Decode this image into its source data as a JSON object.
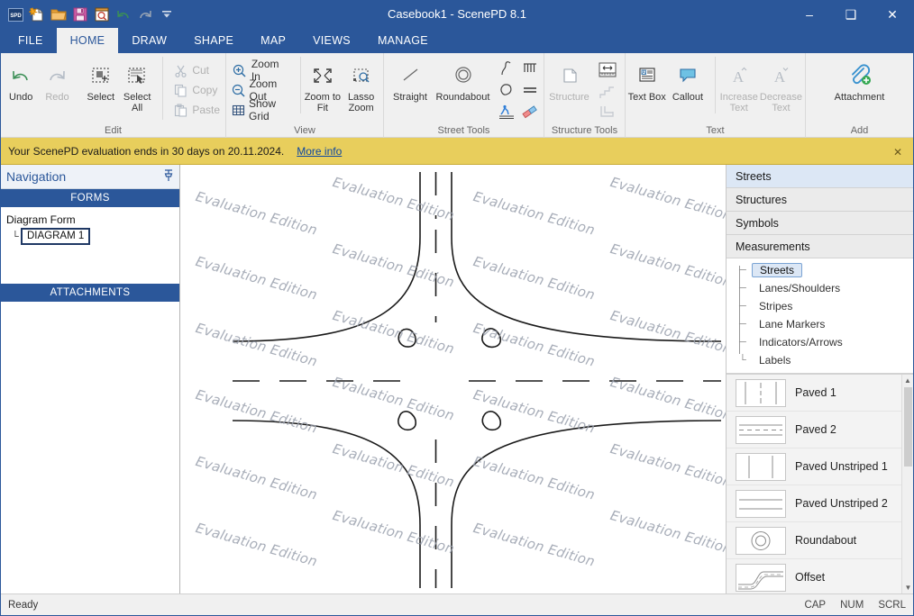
{
  "window": {
    "title": "Casebook1 - ScenePD 8.1",
    "minimize": "–",
    "maximize": "❑",
    "close": "✕"
  },
  "quick_access": [
    {
      "name": "app-logo-icon",
      "label": "SPD"
    },
    {
      "name": "new-casebook-icon",
      "label": "New"
    },
    {
      "name": "open-folder-icon",
      "label": "Open"
    },
    {
      "name": "save-icon",
      "label": "Save"
    },
    {
      "name": "print-preview-icon",
      "label": "Print Preview"
    },
    {
      "name": "undo-icon",
      "label": "Undo"
    },
    {
      "name": "redo-icon",
      "label": "Redo"
    },
    {
      "name": "customize-qat-icon",
      "label": "Customize Quick Access Toolbar"
    }
  ],
  "tabs": [
    {
      "label": "FILE",
      "active": false
    },
    {
      "label": "HOME",
      "active": true
    },
    {
      "label": "DRAW",
      "active": false
    },
    {
      "label": "SHAPE",
      "active": false
    },
    {
      "label": "MAP",
      "active": false
    },
    {
      "label": "VIEWS",
      "active": false
    },
    {
      "label": "MANAGE",
      "active": false
    }
  ],
  "ribbon": {
    "groups": [
      {
        "label": "Edit",
        "big": [
          {
            "label": "Undo",
            "icon": "undo-icon",
            "disabled": false
          },
          {
            "label": "Redo",
            "icon": "redo-icon",
            "disabled": true
          },
          {
            "label": "Select",
            "icon": "select-icon",
            "disabled": false
          },
          {
            "label": "Select All",
            "icon": "select-all-icon",
            "disabled": false
          }
        ],
        "small": [
          {
            "label": "Cut",
            "icon": "cut-icon",
            "disabled": true
          },
          {
            "label": "Copy",
            "icon": "copy-icon",
            "disabled": true
          },
          {
            "label": "Paste",
            "icon": "paste-icon",
            "disabled": true
          }
        ]
      },
      {
        "label": "View",
        "small": [
          {
            "label": "Zoom In",
            "icon": "zoom-in-icon",
            "disabled": false
          },
          {
            "label": "Zoom Out",
            "icon": "zoom-out-icon",
            "disabled": false
          },
          {
            "label": "Show Grid",
            "icon": "grid-icon",
            "disabled": false
          }
        ],
        "big": [
          {
            "label": "Zoom to Fit",
            "icon": "zoom-to-fit-icon",
            "disabled": false
          },
          {
            "label": "Lasso Zoom",
            "icon": "lasso-zoom-icon",
            "disabled": false
          }
        ]
      },
      {
        "label": "Street Tools",
        "big": [
          {
            "label": "Straight",
            "icon": "straight-street-icon",
            "disabled": false
          },
          {
            "label": "Roundabout",
            "icon": "roundabout-icon",
            "disabled": false
          }
        ],
        "grid": [
          {
            "label": "Curved Street",
            "icon": "curve-street-icon"
          },
          {
            "label": "Railroad",
            "icon": "railroad-icon"
          },
          {
            "label": "Free Form Street",
            "icon": "freeform-street-icon"
          },
          {
            "label": "Dashed Stripe",
            "icon": "dashed-stripe-icon"
          },
          {
            "label": "Crosswalk",
            "icon": "crosswalk-icon"
          },
          {
            "label": "Eraser",
            "icon": "eraser-icon"
          }
        ]
      },
      {
        "label": "Structure Tools",
        "big": [
          {
            "label": "Structure",
            "icon": "structure-icon",
            "disabled": true
          }
        ],
        "grid": [
          {
            "label": "Measure Structure",
            "icon": "measure-structure-icon"
          },
          {
            "label": "Stairs",
            "icon": "stairs-icon"
          },
          {
            "label": "Corner Wall",
            "icon": "corner-wall-icon"
          }
        ]
      },
      {
        "label": "Text",
        "big": [
          {
            "label": "Text Box",
            "icon": "text-box-icon",
            "disabled": false
          },
          {
            "label": "Callout",
            "icon": "callout-icon",
            "disabled": false
          },
          {
            "label": "Increase Text",
            "icon": "increase-text-icon",
            "disabled": true
          },
          {
            "label": "Decrease Text",
            "icon": "decrease-text-icon",
            "disabled": true
          }
        ]
      },
      {
        "label": "Add",
        "big": [
          {
            "label": "Attachment",
            "icon": "attachment-icon",
            "disabled": false
          }
        ]
      }
    ]
  },
  "notification": {
    "message": "Your ScenePD evaluation ends in 30 days on 20.11.2024.",
    "link": "More info",
    "close": "✕"
  },
  "navigation": {
    "title": "Navigation",
    "pin_icon": "pin-icon",
    "sections": [
      {
        "label": "FORMS"
      },
      {
        "label": "ATTACHMENTS"
      }
    ],
    "forms": {
      "root": "Diagram Form",
      "child": "DIAGRAM 1",
      "elbow": "└",
      "play": "▶"
    }
  },
  "canvas": {
    "watermark": "Evaluation Edition",
    "watermark_rows": 6,
    "watermark_cols": 3
  },
  "right_panel": {
    "headers": [
      {
        "label": "Streets",
        "active": true
      },
      {
        "label": "Structures",
        "active": false
      },
      {
        "label": "Symbols",
        "active": false
      },
      {
        "label": "Measurements",
        "active": false
      }
    ],
    "tree": [
      {
        "label": "Streets",
        "selected": true
      },
      {
        "label": "Lanes/Shoulders",
        "selected": false
      },
      {
        "label": "Stripes",
        "selected": false
      },
      {
        "label": "Lane Markers",
        "selected": false
      },
      {
        "label": "Indicators/Arrows",
        "selected": false
      },
      {
        "label": "Labels",
        "selected": false
      }
    ],
    "streets": [
      {
        "label": "Paved 1",
        "icon": "paved-1-thumb"
      },
      {
        "label": "Paved 2",
        "icon": "paved-2-thumb"
      },
      {
        "label": "Paved Unstriped 1",
        "icon": "paved-unstriped-1-thumb"
      },
      {
        "label": "Paved Unstriped 2",
        "icon": "paved-unstriped-2-thumb"
      },
      {
        "label": "Roundabout",
        "icon": "roundabout-thumb"
      },
      {
        "label": "Offset",
        "icon": "offset-thumb"
      }
    ],
    "scroll_up": "▲",
    "scroll_down": "▼"
  },
  "statusbar": {
    "status": "Ready",
    "indicators": [
      "CAP",
      "NUM",
      "SCRL"
    ]
  },
  "colors": {
    "accent": "#2b579a",
    "notification_bg": "#e8ce5c",
    "ribbon_bg": "#f0f0f0",
    "selection": "#dce7f5"
  }
}
